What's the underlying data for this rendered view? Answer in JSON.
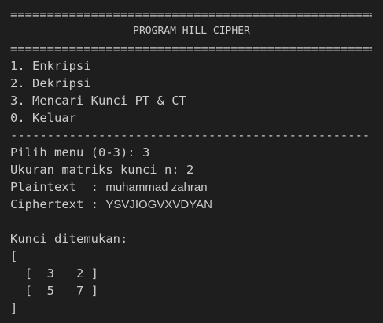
{
  "terminal": {
    "rule_double": "======================================================",
    "rule_single": "------------------------------------------------------",
    "title": "PROGRAM HILL CIPHER",
    "menu": [
      "1. Enkripsi",
      "2. Dekripsi",
      "3. Mencari Kunci PT & CT",
      "0. Keluar"
    ],
    "prompts": {
      "menu_label": "Pilih menu (0-3): ",
      "menu_value": "3",
      "size_label": "Ukuran matriks kunci n: ",
      "size_value": "2",
      "plaintext_label": "Plaintext  : ",
      "plaintext_value": "muhammad zahran",
      "ciphertext_label": "Ciphertext : ",
      "ciphertext_value": "YSVJIOGVXVDYAN"
    },
    "result": {
      "heading": "Kunci ditemukan:",
      "open_bracket": "[",
      "row1": "  [  3   2 ]",
      "row2": "  [  5   7 ]",
      "close_bracket": "]"
    }
  }
}
